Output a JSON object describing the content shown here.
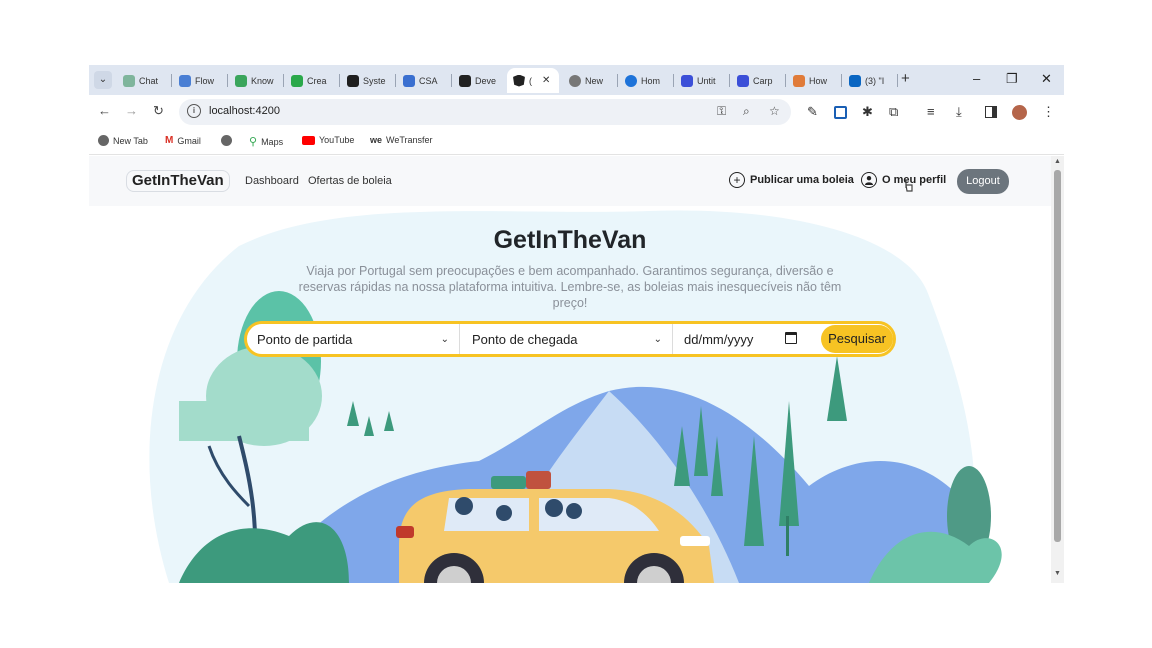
{
  "browser": {
    "tabs": [
      {
        "label": "Chat",
        "color": "#7fb59c"
      },
      {
        "label": "Flow",
        "color": "#4a7fd4"
      },
      {
        "label": "Know",
        "color": "#3aa55c"
      },
      {
        "label": "Crea",
        "color": "#2aa84a"
      },
      {
        "label": "Syste",
        "color": "#1f1f1f"
      },
      {
        "label": "CSA",
        "color": "#3a6fd0"
      },
      {
        "label": "Deve",
        "color": "#222222"
      },
      {
        "label": "(",
        "color": "#222222"
      },
      {
        "label": "New",
        "color": "#777777"
      },
      {
        "label": "Hom",
        "color": "#1e73d9"
      },
      {
        "label": "Untit",
        "color": "#3b4fd8"
      },
      {
        "label": "Carp",
        "color": "#3b4fd8"
      },
      {
        "label": "How",
        "color": "#e07b39"
      },
      {
        "label": "(3) \"I",
        "color": "#0a66c2"
      }
    ],
    "tab_menu_icon": "chevron-down-icon",
    "new_tab_glyph": "+",
    "window_controls": [
      "–",
      "❐",
      "✕"
    ],
    "url": "localhost:4200",
    "bookmarks": [
      {
        "label": "New Tab",
        "color": "#666666"
      },
      {
        "label": "Gmail",
        "color": "#d93025"
      },
      {
        "label": "",
        "color": "#666666"
      },
      {
        "label": "Maps",
        "color": "#34a853"
      },
      {
        "label": "YouTube",
        "color": "#ff0000"
      },
      {
        "label": "WeTransfer",
        "color": "#222222"
      }
    ]
  },
  "app": {
    "brand": "GetInTheVan",
    "nav_links": [
      "Dashboard",
      "Ofertas de boleia"
    ],
    "publish_label": "Publicar uma boleia",
    "profile_label": "O meu perfil",
    "logout_label": "Logout",
    "hero": {
      "title": "GetInTheVan",
      "description": "Viaja por Portugal sem preocupações e bem acompanhado. Garantimos segurança, diversão e reservas rápidas na nossa plataforma intuitiva. Lembre-se, as boleias mais inesquecíveis não têm preço!"
    },
    "search": {
      "origin_placeholder": "Ponto de partida",
      "destination_placeholder": "Ponto de chegada",
      "date_placeholder": "dd/mm/yyyy",
      "button_label": "Pesquisar"
    }
  },
  "colors": {
    "accent": "#f7c323",
    "logout_bg": "#6c757d",
    "car": "#f5c96b",
    "hills": "#7fa7ea",
    "trees": "#3d9a7d"
  }
}
